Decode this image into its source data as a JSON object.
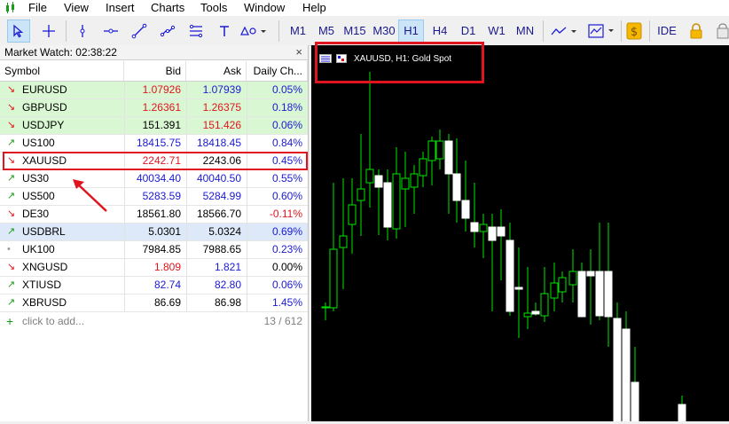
{
  "menu": [
    "File",
    "View",
    "Insert",
    "Charts",
    "Tools",
    "Window",
    "Help"
  ],
  "toolbar": {
    "timeframes": [
      "M1",
      "M5",
      "M15",
      "M30",
      "H1",
      "H4",
      "D1",
      "W1",
      "MN"
    ],
    "active_timeframe": "H1",
    "ide_label": "IDE"
  },
  "market_watch": {
    "title": "Market Watch: 02:38:22",
    "columns": [
      "Symbol",
      "Bid",
      "Ask",
      "Daily Ch..."
    ],
    "rows": [
      {
        "symbol": "EURUSD",
        "bid": "1.07926",
        "ask": "1.07939",
        "change": "0.05%",
        "direction": "down",
        "bid_color": "#e0141e",
        "ask_color": "#1a1ad4",
        "change_color": "#1a1ad4",
        "bg": "#d9f7d2"
      },
      {
        "symbol": "GBPUSD",
        "bid": "1.26361",
        "ask": "1.26375",
        "change": "0.18%",
        "direction": "down",
        "bid_color": "#e0141e",
        "ask_color": "#e0141e",
        "change_color": "#1a1ad4",
        "bg": "#d9f7d2"
      },
      {
        "symbol": "USDJPY",
        "bid": "151.391",
        "ask": "151.426",
        "change": "0.06%",
        "direction": "down",
        "bid_color": "#000000",
        "ask_color": "#e0141e",
        "change_color": "#1a1ad4",
        "bg": "#d9f7d2"
      },
      {
        "symbol": "US100",
        "bid": "18415.75",
        "ask": "18418.45",
        "change": "0.84%",
        "direction": "up",
        "bid_color": "#1a1ad4",
        "ask_color": "#1a1ad4",
        "change_color": "#1a1ad4",
        "bg": "#ffffff"
      },
      {
        "symbol": "XAUUSD",
        "bid": "2242.71",
        "ask": "2243.06",
        "change": "0.45%",
        "direction": "down",
        "bid_color": "#e0141e",
        "ask_color": "#000000",
        "change_color": "#1a1ad4",
        "bg": "#ffffff"
      },
      {
        "symbol": "US30",
        "bid": "40034.40",
        "ask": "40040.50",
        "change": "0.55%",
        "direction": "up",
        "bid_color": "#1a1ad4",
        "ask_color": "#1a1ad4",
        "change_color": "#1a1ad4",
        "bg": "#ffffff"
      },
      {
        "symbol": "US500",
        "bid": "5283.59",
        "ask": "5284.99",
        "change": "0.60%",
        "direction": "up",
        "bid_color": "#1a1ad4",
        "ask_color": "#1a1ad4",
        "change_color": "#1a1ad4",
        "bg": "#ffffff"
      },
      {
        "symbol": "DE30",
        "bid": "18561.80",
        "ask": "18566.70",
        "change": "-0.11%",
        "direction": "down",
        "bid_color": "#000000",
        "ask_color": "#000000",
        "change_color": "#e0141e",
        "bg": "#ffffff"
      },
      {
        "symbol": "USDBRL",
        "bid": "5.0301",
        "ask": "5.0324",
        "change": "0.69%",
        "direction": "up",
        "bid_color": "#000000",
        "ask_color": "#000000",
        "change_color": "#1a1ad4",
        "bg": "#dde8f8"
      },
      {
        "symbol": "UK100",
        "bid": "7984.85",
        "ask": "7988.65",
        "change": "0.23%",
        "direction": "neutral",
        "bid_color": "#000000",
        "ask_color": "#000000",
        "change_color": "#1a1ad4",
        "bg": "#ffffff"
      },
      {
        "symbol": "XNGUSD",
        "bid": "1.809",
        "ask": "1.821",
        "change": "0.00%",
        "direction": "down",
        "bid_color": "#e0141e",
        "ask_color": "#1a1ad4",
        "change_color": "#000000",
        "bg": "#ffffff"
      },
      {
        "symbol": "XTIUSD",
        "bid": "82.74",
        "ask": "82.80",
        "change": "0.06%",
        "direction": "up",
        "bid_color": "#1a1ad4",
        "ask_color": "#1a1ad4",
        "change_color": "#1a1ad4",
        "bg": "#ffffff"
      },
      {
        "symbol": "XBRUSD",
        "bid": "86.69",
        "ask": "86.98",
        "change": "1.45%",
        "direction": "up",
        "bid_color": "#000000",
        "ask_color": "#000000",
        "change_color": "#1a1ad4",
        "bg": "#ffffff"
      }
    ],
    "add_label": "click to add...",
    "count": "13 / 612",
    "highlighted_symbol": "XAUUSD"
  },
  "chart": {
    "label": "XAUUSD, H1:  Gold Spot",
    "bull_color": "#ffffff",
    "wick_color": "#00e600",
    "background": "#000000"
  },
  "colors": {
    "highlight_red": "#e0141e",
    "arrow_up": "#1a9b1a",
    "arrow_down": "#e0141e"
  }
}
